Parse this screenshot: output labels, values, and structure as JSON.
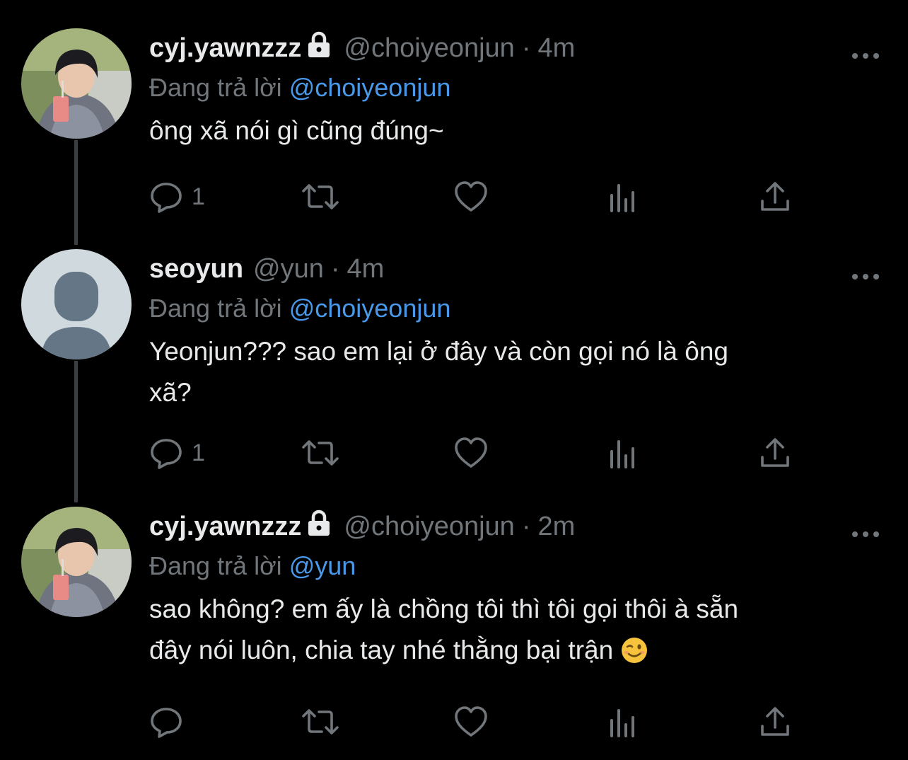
{
  "thread": {
    "tweets": [
      {
        "name": "cyj.yawnzzz",
        "locked": true,
        "handle": "@choiyeonjun",
        "dot": "·",
        "time": "4m",
        "reply_prefix": "Đang trả lời",
        "reply_to": "@choiyeonjun",
        "text": "ông xã nói gì cũng đúng~",
        "reply_count": "1",
        "avatar": "photo"
      },
      {
        "name": "seoyun",
        "locked": false,
        "handle": "@yun",
        "dot": "·",
        "time": "4m",
        "reply_prefix": "Đang trả lời",
        "reply_to": "@choiyeonjun",
        "text": "Yeonjun??? sao em lại ở đây và còn gọi nó là ông\nxã?",
        "reply_count": "1",
        "avatar": "default"
      },
      {
        "name": "cyj.yawnzzz",
        "locked": true,
        "handle": "@choiyeonjun",
        "dot": "·",
        "time": "2m",
        "reply_prefix": "Đang trả lời",
        "reply_to": "@yun",
        "text": "sao không? em ấy là chồng tôi thì tôi gọi thôi à sẵn\nđây nói luôn, chia tay nhé thằng bại trận ",
        "text_emoji": "winking-face-emoji",
        "reply_count": "",
        "avatar": "photo"
      }
    ]
  },
  "icons": {
    "reply": "reply-icon",
    "retweet": "retweet-icon",
    "like": "heart-icon",
    "views": "views-icon",
    "share": "share-icon",
    "more": "more-icon",
    "lock": "lock-icon"
  },
  "colors": {
    "background": "#000000",
    "text": "#e7e9ea",
    "muted": "#71767b",
    "mention": "#4a98e9",
    "thread_line": "#3a3d41"
  }
}
